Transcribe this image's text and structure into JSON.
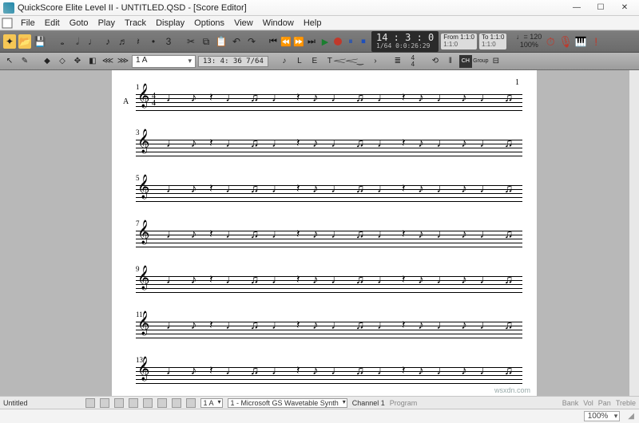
{
  "title": "QuickScore Elite Level II  -  UNTITLED.QSD - [Score Editor]",
  "menu": [
    "File",
    "Edit",
    "Goto",
    "Play",
    "Track",
    "Display",
    "Options",
    "View",
    "Window",
    "Help"
  ],
  "time": {
    "main": "14 : 3 : 0",
    "sub": "1/64  0:0:26:29"
  },
  "locator_from": {
    "label": "From",
    "val": "1:1:0",
    "sub": "1:1:0"
  },
  "locator_to": {
    "label": "To",
    "val": "1:1:0",
    "sub": "1:1:0"
  },
  "tempo": {
    "bpm": "♩= 120",
    "pct": "100%"
  },
  "track_sel": "1 A",
  "measure_disp": "13:  4: 36   7/64",
  "dyn_letters": [
    "L",
    "E",
    "T"
  ],
  "page_number": "1",
  "systems": [
    {
      "bar": "1",
      "part": "A",
      "show_timesig": true
    },
    {
      "bar": "3"
    },
    {
      "bar": "5"
    },
    {
      "bar": "7"
    },
    {
      "bar": "9"
    },
    {
      "bar": "11"
    },
    {
      "bar": "13"
    }
  ],
  "timesig": {
    "top": "4",
    "bot": "4"
  },
  "status": {
    "doc": "Untitled",
    "track": "1  A",
    "device": "1 - Microsoft GS Wavetable Synth",
    "channel": "Channel  1",
    "program": "Program",
    "right": [
      "Bank",
      "Vol",
      "Pan",
      "Treble"
    ]
  },
  "zoom": "100%",
  "watermark": "wsxdn.com"
}
